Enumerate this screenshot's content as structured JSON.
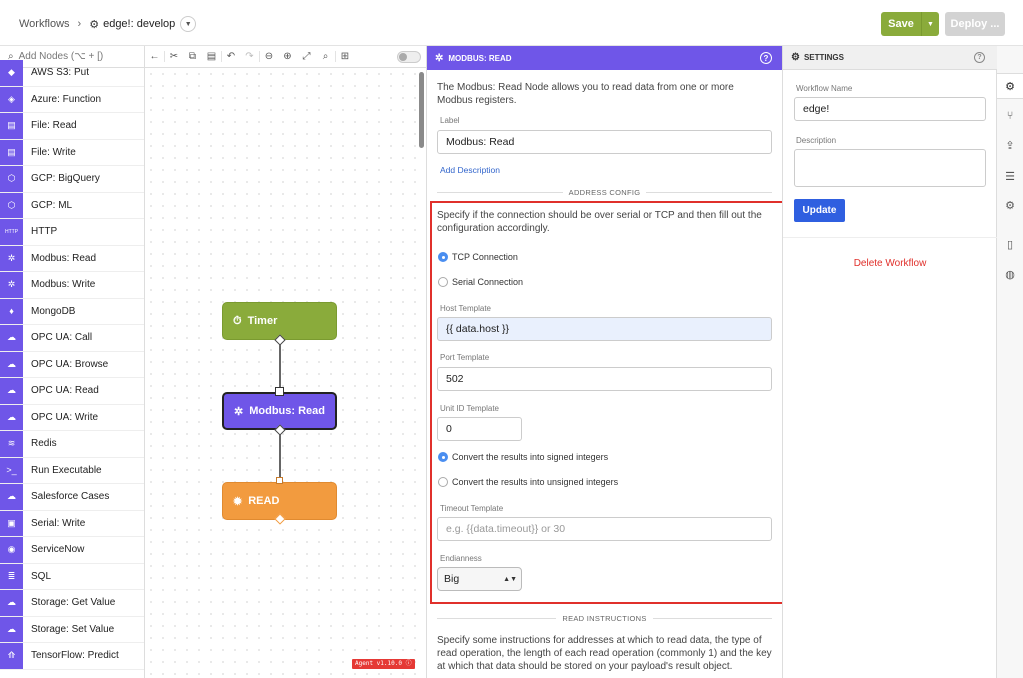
{
  "header": {
    "breadcrumb_root": "Workflows",
    "workflow_name": "edge!: develop",
    "save_label": "Save",
    "deploy_label": "Deploy ..."
  },
  "palette": {
    "search_placeholder": "Add Nodes (⌥ + [)",
    "items": [
      {
        "label": "AWS S3: Put",
        "icon": "aws-icon"
      },
      {
        "label": "Azure: Function",
        "icon": "azure-icon"
      },
      {
        "label": "File: Read",
        "icon": "file-icon"
      },
      {
        "label": "File: Write",
        "icon": "file-icon"
      },
      {
        "label": "GCP: BigQuery",
        "icon": "gcp-icon"
      },
      {
        "label": "GCP: ML",
        "icon": "gcp-icon"
      },
      {
        "label": "HTTP",
        "icon": "http-icon"
      },
      {
        "label": "Modbus: Read",
        "icon": "modbus-icon"
      },
      {
        "label": "Modbus: Write",
        "icon": "modbus-icon"
      },
      {
        "label": "MongoDB",
        "icon": "mongodb-icon"
      },
      {
        "label": "OPC UA: Call",
        "icon": "opcua-icon"
      },
      {
        "label": "OPC UA: Browse",
        "icon": "opcua-icon"
      },
      {
        "label": "OPC UA: Read",
        "icon": "opcua-icon"
      },
      {
        "label": "OPC UA: Write",
        "icon": "opcua-icon"
      },
      {
        "label": "Redis",
        "icon": "redis-icon"
      },
      {
        "label": "Run Executable",
        "icon": "terminal-icon"
      },
      {
        "label": "Salesforce Cases",
        "icon": "salesforce-icon"
      },
      {
        "label": "Serial: Write",
        "icon": "serial-icon"
      },
      {
        "label": "ServiceNow",
        "icon": "servicenow-icon"
      },
      {
        "label": "SQL",
        "icon": "database-icon"
      },
      {
        "label": "Storage: Get Value",
        "icon": "cloud-icon"
      },
      {
        "label": "Storage: Set Value",
        "icon": "cloud-icon"
      },
      {
        "label": "TensorFlow: Predict",
        "icon": "tensorflow-icon"
      }
    ]
  },
  "canvas": {
    "nodes": [
      {
        "label": "Timer",
        "color": "#8aab3b",
        "icon": "stopwatch-icon"
      },
      {
        "label": "Modbus: Read",
        "color": "#6f56e8",
        "icon": "modbus-icon"
      },
      {
        "label": "READ",
        "color": "#f29b3f",
        "icon": "bug-icon"
      }
    ],
    "version": "Agent v1.10.0"
  },
  "editor": {
    "title": "MODBUS: READ",
    "description": "The Modbus: Read Node allows you to read data from one or more Modbus registers.",
    "label_caption": "Label",
    "label_value": "Modbus: Read",
    "add_description": "Add Description",
    "address_config_title": "ADDRESS CONFIG",
    "connection_help": "Specify if the connection should be over serial or TCP and then fill out the configuration accordingly.",
    "tcp_option": "TCP Connection",
    "serial_option": "Serial Connection",
    "host_caption": "Host Template",
    "host_value": "{{ data.host }}",
    "port_caption": "Port Template",
    "port_value": "502",
    "unit_caption": "Unit ID Template",
    "unit_value": "0",
    "signed_option": "Convert the results into signed integers",
    "unsigned_option": "Convert the results into unsigned integers",
    "timeout_caption": "Timeout Template",
    "timeout_placeholder": "e.g. {{data.timeout}} or 30",
    "endianness_caption": "Endianness",
    "endianness_value": "Big",
    "read_instructions_title": "READ INSTRUCTIONS",
    "read_instructions_text": "Specify some instructions for addresses at which to read data, the type of read operation, the length of each read operation (commonly 1) and the key at which that data should be stored on your payload's result object."
  },
  "settings": {
    "title": "SETTINGS",
    "name_caption": "Workflow Name",
    "name_value": "edge!",
    "description_caption": "Description",
    "update_label": "Update",
    "delete_label": "Delete Workflow"
  },
  "colors": {
    "accent": "#6f56e8",
    "save": "#8aab3b",
    "danger": "#e0302b",
    "primary_button": "#2f5fe0"
  }
}
